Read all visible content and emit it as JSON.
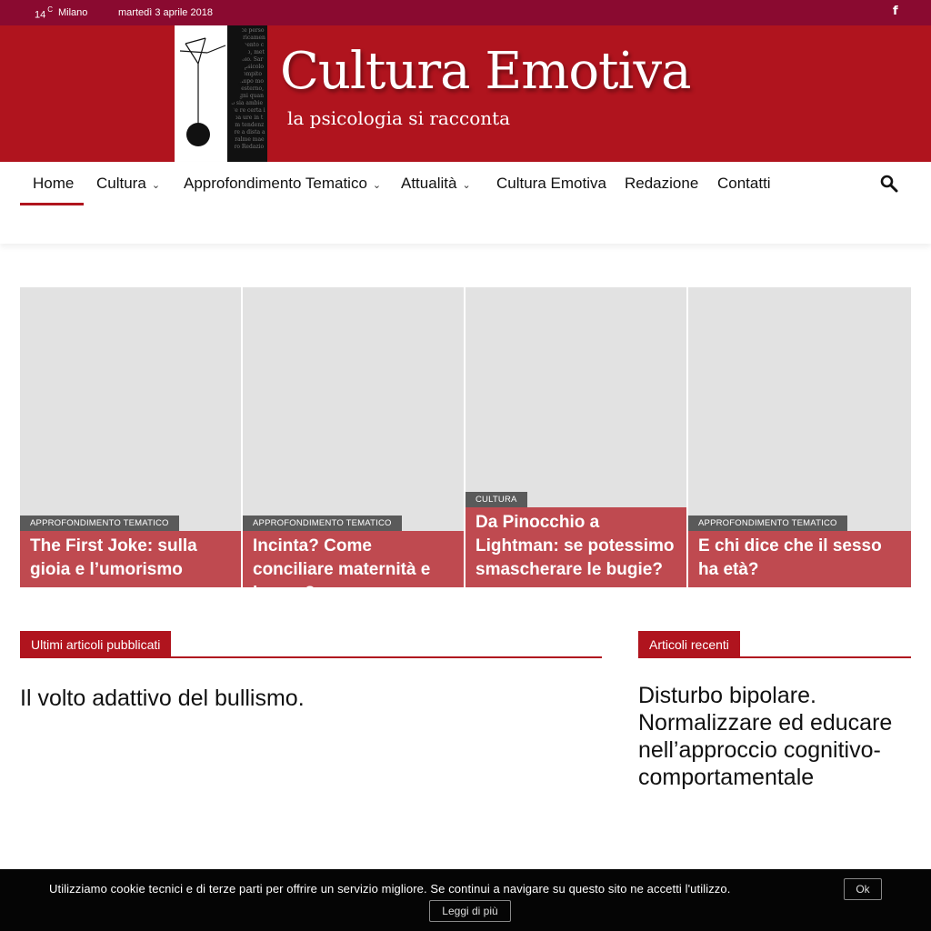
{
  "topbar": {
    "temperature": "14",
    "unit": "C",
    "city": "Milano",
    "date": "martedì 3 aprile 2018",
    "facebook_icon": "f"
  },
  "header": {
    "title": "Cultura Emotiva",
    "subtitle": "la psicologia si racconta",
    "logo_strip_text": "invece persona il ricamento dimento che Mito, metà sicolo. Sareb la psicolog il compito di tempo mondo esterno, in ogni quanto sia ambiente re certa imba ure in term tendenza re a dista aturalme maestro Redazio"
  },
  "nav": {
    "items": [
      {
        "label": "Home"
      },
      {
        "label": "Cultura",
        "dropdown": true
      },
      {
        "label": "Approfondimento Tematico",
        "dropdown": true
      },
      {
        "label": "Attualità",
        "dropdown": true
      },
      {
        "label": "Cultura Emotiva"
      },
      {
        "label": "Redazione"
      },
      {
        "label": "Contatti"
      }
    ],
    "chevron": "⌄"
  },
  "featured": [
    {
      "category": "APPROFONDIMENTO TEMATICO",
      "title": "The First Joke: sulla gioia e l’umorismo"
    },
    {
      "category": "APPROFONDIMENTO TEMATICO",
      "title": "Incinta? Come conciliare maternità e lavoro?"
    },
    {
      "category": "CULTURA",
      "title": "Da Pinocchio a Lightman: se potessimo smascherare le bugie?"
    },
    {
      "category": "APPROFONDIMENTO TEMATICO",
      "title": "E chi dice che il sesso ha età?"
    }
  ],
  "latest": {
    "heading": "Ultimi articoli pubblicati",
    "article_title": "Il volto adattivo del bullismo."
  },
  "recent": {
    "heading": "Articoli recenti",
    "article_title": "Disturbo bipolare. Normalizzare ed educare nell’approccio cognitivo-comportamentale"
  },
  "cookie": {
    "message": "Utilizziamo cookie tecnici e di terze parti per offrire un servizio migliore. Se continui a navigare su questo sito ne accetti l'utilizzo.",
    "ok_label": "Ok",
    "more_label": "Leggi di più"
  },
  "colors": {
    "topbar": "#8a0a30",
    "brand_red": "#b0141e",
    "card_title_bg": "#bf4a50",
    "category_bg": "#5a5a5a",
    "placeholder": "#e2e2e2",
    "cookie_bg": "#050505"
  }
}
